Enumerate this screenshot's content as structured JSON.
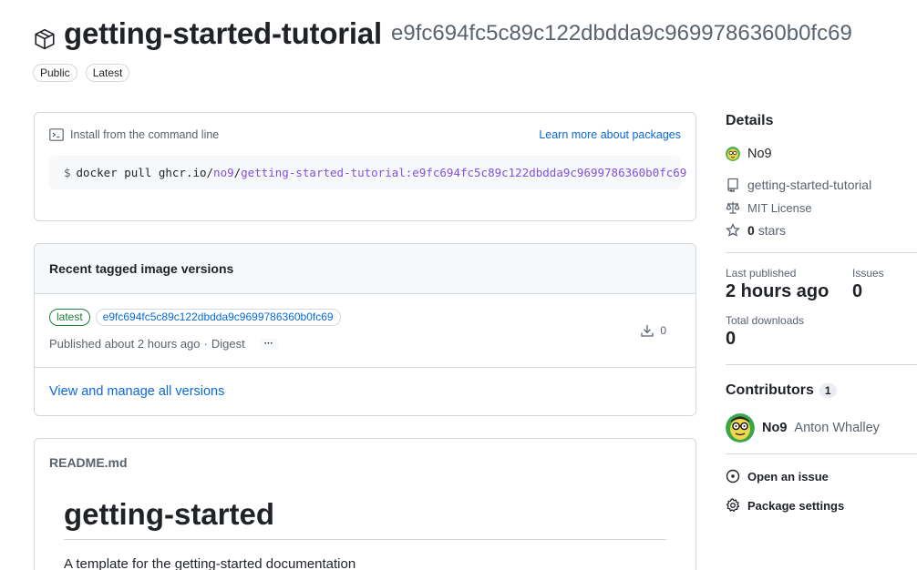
{
  "package": {
    "name": "getting-started-tutorial",
    "digest": "e9fc694fc5c89c122dbdda9c9699786360b0fc69",
    "labels": [
      "Public",
      "Latest"
    ]
  },
  "install": {
    "heading": "Install from the command line",
    "learn_more": "Learn more about packages",
    "dollar": "$",
    "cmd_prefix": "docker pull ghcr.io/",
    "cmd_ns": "no9",
    "cmd_slash": "/",
    "cmd_image": "getting-started-tutorial:e9fc694fc5c89c122dbdda9c9699786360b0fc69"
  },
  "versions": {
    "heading": "Recent tagged image versions",
    "items": [
      {
        "tag": "latest",
        "digest": "e9fc694fc5c89c122dbdda9c9699786360b0fc69",
        "published": "Published about 2 hours ago",
        "dot": "·",
        "digest_label": "Digest",
        "more": "···",
        "downloads": "0"
      }
    ],
    "view_all": "View and manage all versions"
  },
  "readme": {
    "filename": "README.md",
    "h1": "getting-started",
    "text": "A template for the getting-started documentation"
  },
  "details": {
    "heading": "Details",
    "owner": "No9",
    "repo": "getting-started-tutorial",
    "license": "MIT License",
    "stars_count": "0",
    "stars_label": "stars",
    "last_published_label": "Last published",
    "last_published_value": "2 hours ago",
    "issues_label": "Issues",
    "issues_value": "0",
    "downloads_label": "Total downloads",
    "downloads_value": "0"
  },
  "contributors": {
    "heading": "Contributors",
    "count": "1",
    "items": [
      {
        "login": "No9",
        "name": "Anton Whalley"
      }
    ]
  },
  "actions": {
    "open_issue": "Open an issue",
    "package_settings": "Package settings"
  },
  "colors": {
    "link": "#0969da",
    "tag_green": "#1a7f37",
    "namespace_purple": "#8250df",
    "border": "#d1d9e0",
    "muted": "#59636e"
  }
}
